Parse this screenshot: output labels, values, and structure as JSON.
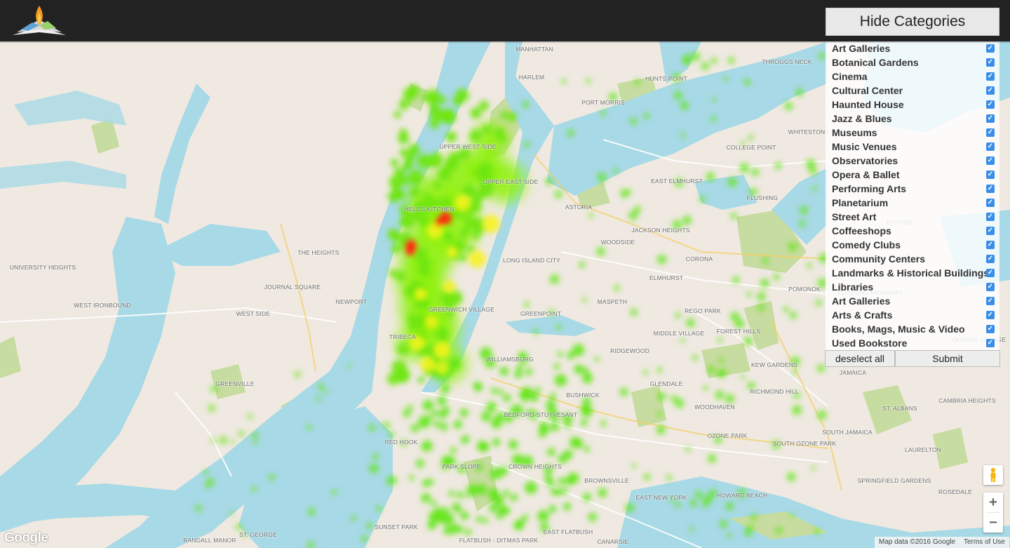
{
  "header": {
    "hide_button_label": "Hide Categories"
  },
  "categories": [
    {
      "label": "Art Galleries",
      "checked": true
    },
    {
      "label": "Botanical Gardens",
      "checked": true
    },
    {
      "label": "Cinema",
      "checked": true
    },
    {
      "label": "Cultural Center",
      "checked": true
    },
    {
      "label": "Haunted House",
      "checked": true
    },
    {
      "label": "Jazz & Blues",
      "checked": true
    },
    {
      "label": "Museums",
      "checked": true
    },
    {
      "label": "Music Venues",
      "checked": true
    },
    {
      "label": "Observatories",
      "checked": true
    },
    {
      "label": "Opera & Ballet",
      "checked": true
    },
    {
      "label": "Performing Arts",
      "checked": true
    },
    {
      "label": "Planetarium",
      "checked": true
    },
    {
      "label": "Street Art",
      "checked": true
    },
    {
      "label": "Coffeeshops",
      "checked": true
    },
    {
      "label": "Comedy Clubs",
      "checked": true
    },
    {
      "label": "Community Centers",
      "checked": true
    },
    {
      "label": "Landmarks & Historical Buildings",
      "checked": true
    },
    {
      "label": "Libraries",
      "checked": true
    },
    {
      "label": "Art Galleries",
      "checked": true
    },
    {
      "label": "Arts & Crafts",
      "checked": true
    },
    {
      "label": "Books, Mags, Music & Video",
      "checked": true
    },
    {
      "label": "Used Bookstore",
      "checked": true
    }
  ],
  "panel_buttons": {
    "deselect_label": "deselect all",
    "submit_label": "Submit"
  },
  "map": {
    "zoom_in": "+",
    "zoom_out": "−",
    "logo_text": "Google",
    "attribution": "Map data ©2016 Google",
    "terms": "Terms of Use",
    "place_labels": [
      "MANHATTAN",
      "HARLEM",
      "THROGGS NECK",
      "HUNTS POINT",
      "PORT MORRIS",
      "WHITESTONE",
      "COLLEGE POINT",
      "UPPER WEST SIDE",
      "UPPER EAST SIDE",
      "EAST ELMHURST",
      "FLUSHING",
      "HELL'S KITCHEN",
      "ASTORIA",
      "JACKSON HEIGHTS",
      "WOODSIDE",
      "CORONA",
      "BAYSIDE",
      "LONG ISLAND CITY",
      "ELMHURST",
      "POMONOK",
      "UNIVERSITY HEIGHTS",
      "THE HEIGHTS",
      "JOURNAL SQUARE",
      "NEWPORT",
      "WEST IRONBOUND",
      "WEST SIDE",
      "GREENPOINT",
      "MASPETH",
      "REGO PARK",
      "MIDDLE VILLAGE",
      "FOREST HILLS",
      "TRIBECA",
      "GREENWICH VILLAGE",
      "WILLIAMSBURG",
      "RIDGEWOOD",
      "KEW GARDENS",
      "GREENVILLE",
      "BUSHWICK",
      "GLENDALE",
      "JAMAICA",
      "RICHMOND HILL",
      "WOODHAVEN",
      "BEDFORD-STUYVESANT",
      "ST. ALBANS",
      "CAMBRIA HEIGHTS",
      "RED HOOK",
      "OZONE PARK",
      "SOUTH OZONE PARK",
      "SOUTH JAMAICA",
      "LAURELTON",
      "PARK SLOPE",
      "CROWN HEIGHTS",
      "BROWNSVILLE",
      "SPRINGFIELD GARDENS",
      "ROSEDALE",
      "EAST NEW YORK",
      "HOWARD BEACH",
      "SUNSET PARK",
      "EAST FLATBUSH",
      "FLATBUSH - DITMAS PARK",
      "CANARSIE",
      "RANDALL MANOR",
      "ST. GEORGE",
      "QUEENS VILLAGE",
      "FLUSHING MEADOWS"
    ]
  }
}
